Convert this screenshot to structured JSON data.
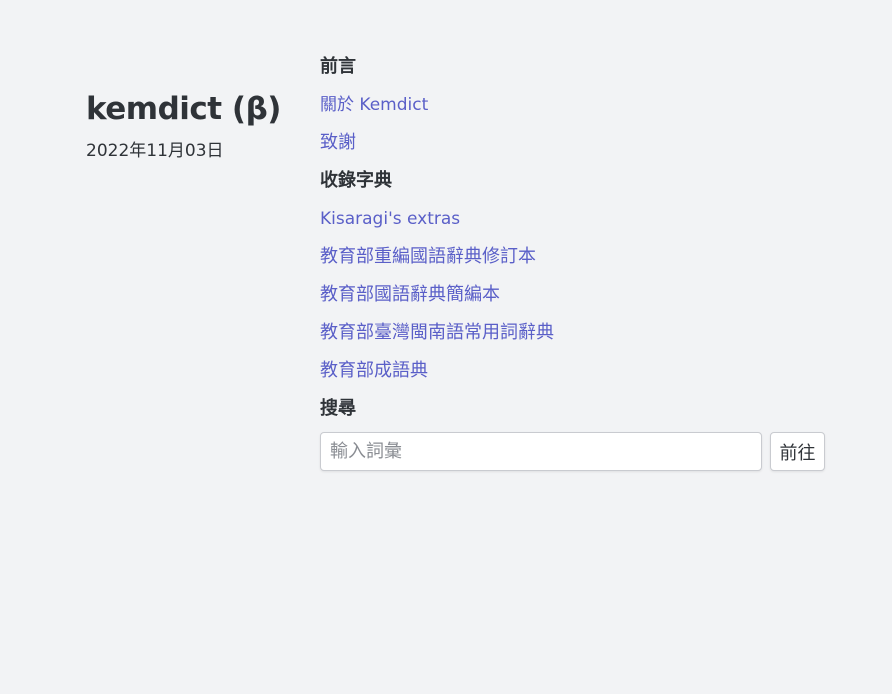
{
  "site": {
    "title": "kemdict (β)",
    "date": "2022年11月03日"
  },
  "sections": {
    "preface": {
      "heading": "前言",
      "links": [
        {
          "label": "關於 Kemdict"
        },
        {
          "label": "致謝"
        }
      ]
    },
    "dictionaries": {
      "heading": "收錄字典",
      "links": [
        {
          "label": "Kisaragi's extras"
        },
        {
          "label": "教育部重編國語辭典修訂本"
        },
        {
          "label": "教育部國語辭典簡編本"
        },
        {
          "label": "教育部臺灣閩南語常用詞辭典"
        },
        {
          "label": "教育部成語典"
        }
      ]
    },
    "search": {
      "heading": "搜尋",
      "input_value": "",
      "placeholder": "輸入詞彙",
      "button_label": "前往"
    }
  },
  "colors": {
    "background": "#f2f3f5",
    "link": "#5a5fc8",
    "text": "#2f3338"
  }
}
